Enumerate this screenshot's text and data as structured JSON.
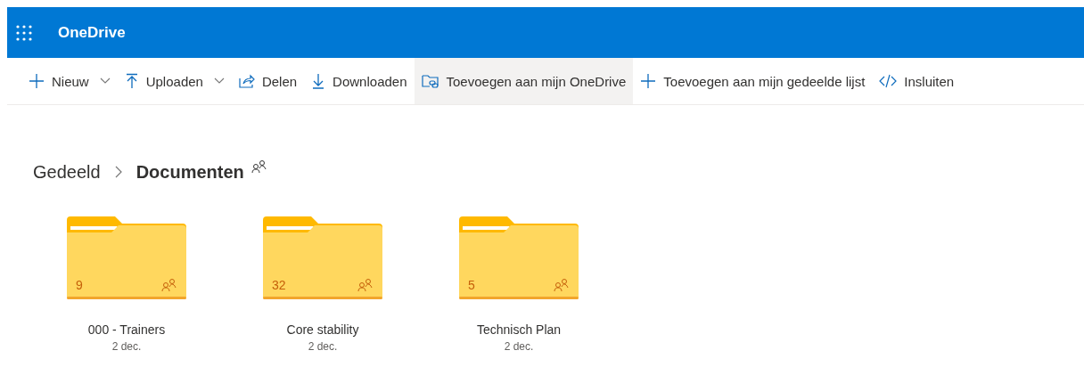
{
  "header": {
    "app_title": "OneDrive"
  },
  "toolbar": [
    {
      "label": "Nieuw",
      "dropdown": true,
      "highlighted": false
    },
    {
      "label": "Uploaden",
      "dropdown": true,
      "highlighted": false
    },
    {
      "label": "Delen",
      "dropdown": false,
      "highlighted": false
    },
    {
      "label": "Downloaden",
      "dropdown": false,
      "highlighted": false
    },
    {
      "label": "Toevoegen aan mijn OneDrive",
      "dropdown": false,
      "highlighted": true
    },
    {
      "label": "Toevoegen aan mijn gedeelde lijst",
      "dropdown": false,
      "highlighted": false
    },
    {
      "label": "Insluiten",
      "dropdown": false,
      "highlighted": false
    }
  ],
  "breadcrumb": [
    {
      "label": "Gedeeld",
      "current": false
    },
    {
      "label": "Documenten",
      "current": true
    }
  ],
  "folders": [
    {
      "name": "000 - Trainers",
      "date": "2 dec.",
      "count": "9",
      "shared": true
    },
    {
      "name": "Core stability",
      "date": "2 dec.",
      "count": "32",
      "shared": true
    },
    {
      "name": "Technisch Plan",
      "date": "2 dec.",
      "count": "5",
      "shared": true
    }
  ]
}
